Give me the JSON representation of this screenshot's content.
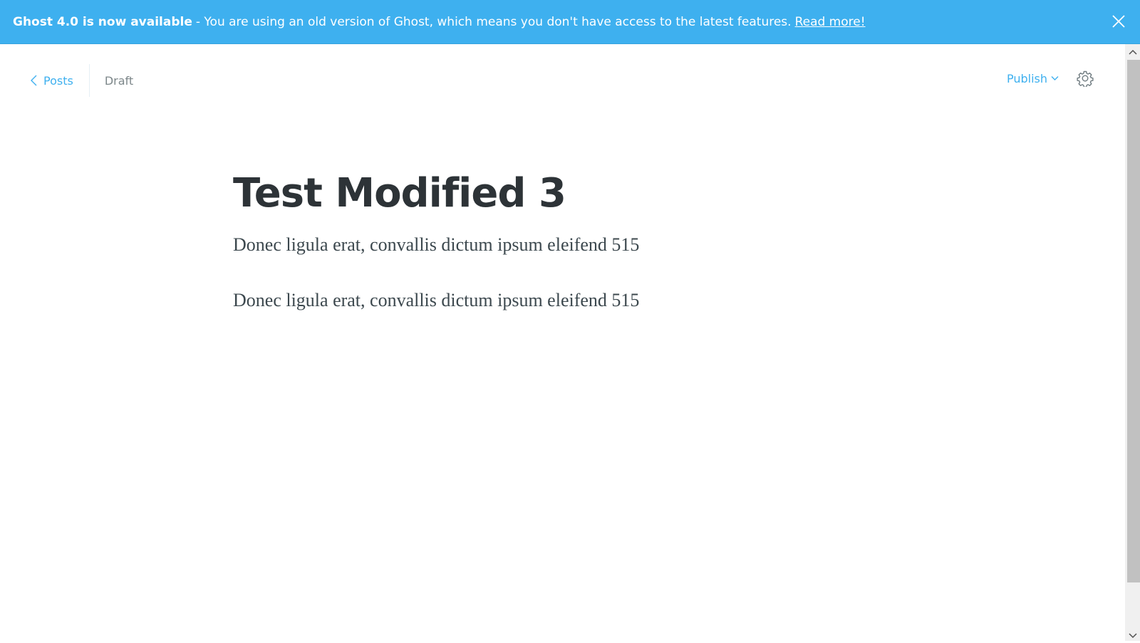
{
  "banner": {
    "heading": "Ghost 4.0 is now available",
    "message": " - You are using an old version of Ghost, which means you don't have access to the latest features.",
    "link_label": "Read more!",
    "close_icon": "close-icon",
    "background": "#3eb0ef"
  },
  "header": {
    "back_label": "Posts",
    "back_icon": "chevron-left-icon",
    "status": "Draft",
    "publish_label": "Publish",
    "publish_icon": "chevron-down-icon",
    "settings_icon": "gear-icon"
  },
  "post": {
    "title": "Test Modified 3",
    "paragraphs": [
      "Donec ligula erat, convallis dictum ipsum eleifend 515",
      "Donec ligula erat, convallis dictum ipsum eleifend 515"
    ]
  },
  "colors": {
    "accent": "#3eb0ef",
    "title_text": "#2d3337",
    "muted_text": "#7d878a"
  }
}
